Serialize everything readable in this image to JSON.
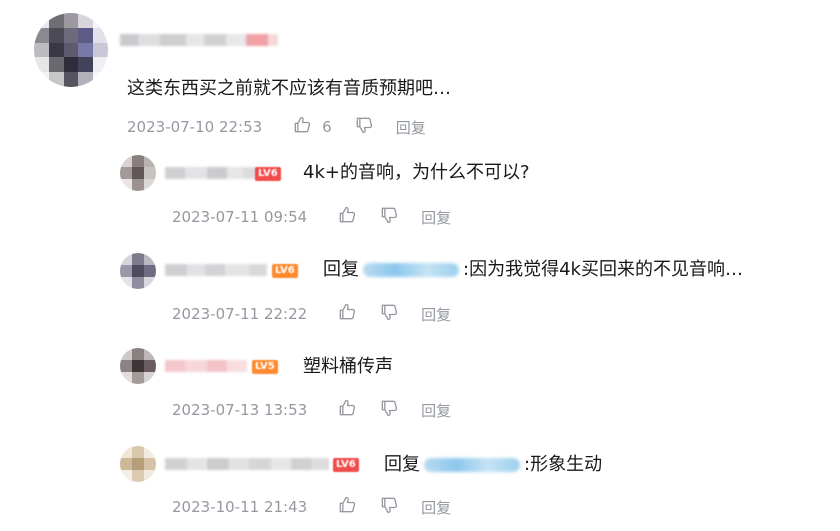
{
  "main_comment": {
    "level_badge": "",
    "content": "这类东西买之前就不应该有音质预期吧…",
    "time": "2023-07-10 22:53",
    "like_count": "6",
    "reply_label": "回复"
  },
  "replies": [
    {
      "level_badge": "LV6",
      "reply_prefix": "",
      "content": "4k+的音响，为什么不可以?",
      "time": "2023-07-11 09:54",
      "reply_label": "回复"
    },
    {
      "level_badge": "LV6",
      "reply_prefix": "回复",
      "content": ":因为我觉得4k买回来的不见音响…",
      "time": "2023-07-11 22:22",
      "reply_label": "回复"
    },
    {
      "level_badge": "LV5",
      "reply_prefix": "",
      "content": "塑料桶传声",
      "time": "2023-07-13 13:53",
      "reply_label": "回复"
    },
    {
      "level_badge": "LV6",
      "reply_prefix": "回复",
      "content": ":形象生动",
      "time": "2023-10-11 21:43",
      "reply_label": "回复"
    }
  ],
  "colors": {
    "text": "#18191c",
    "meta": "#9499a0",
    "level_red": "#f04c49",
    "level_orange": "#ff8a2f",
    "mention": "#8cc7ec"
  },
  "icons": [
    "thumbs-up-icon",
    "thumbs-down-icon"
  ]
}
